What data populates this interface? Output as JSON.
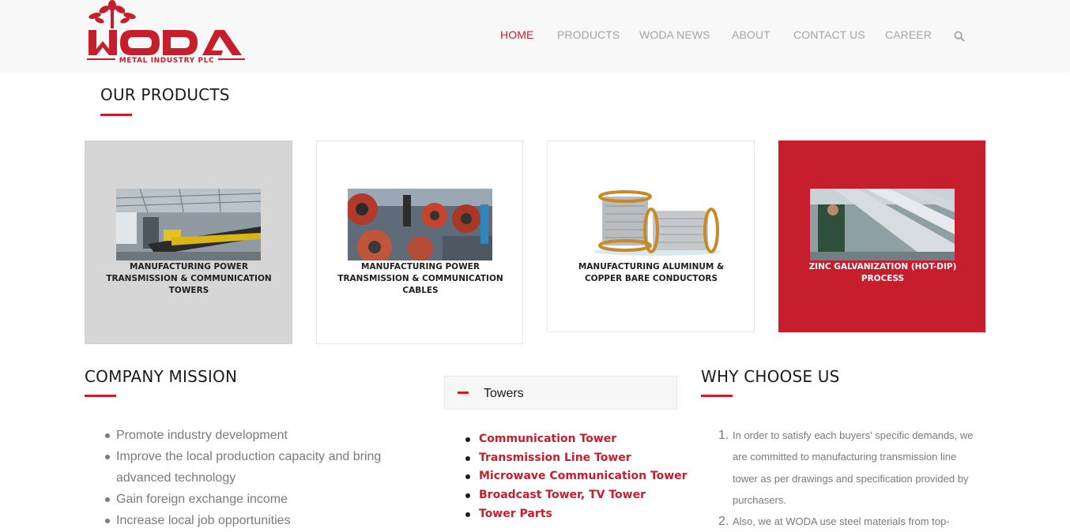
{
  "header": {
    "logo_wordmark": "WODA",
    "logo_tagline": "METAL INDUSTRY PLC",
    "nav": [
      {
        "label": "HOME",
        "active": true
      },
      {
        "label": "PRODUCTS",
        "active": false
      },
      {
        "label": "WODA NEWS",
        "active": false
      },
      {
        "label": "ABOUT",
        "active": false
      },
      {
        "label": "CONTACT US",
        "active": false
      },
      {
        "label": "CAREER",
        "active": false
      }
    ],
    "search_icon": "search-icon"
  },
  "products": {
    "title": "OUR PRODUCTS",
    "items": [
      {
        "caption": "MANUFACTURING POWER TRANSMISSION & COMMUNICATION TOWERS",
        "image": "factory-tower-photo"
      },
      {
        "caption": "MANUFACTURING POWER TRANSMISSION & COMMUNICATION CABLES",
        "image": "cable-factory-photo"
      },
      {
        "caption": "MANUFACTURING ALUMINUM & COPPER BARE CONDUCTORS",
        "image": "wire-spools-photo"
      },
      {
        "caption": "ZINC GALVANIZATION (HOT-DIP) PROCESS",
        "image": "galvanization-photo"
      }
    ]
  },
  "mission": {
    "title": "COMPANY MISSION",
    "items": [
      "Promote industry development",
      "Improve the local production capacity and bring advanced technology",
      "Gain foreign exchange income",
      "Increase local job opportunities"
    ]
  },
  "towers": {
    "accordion_label": "Towers",
    "items": [
      "Communication Tower",
      "Transmission Line Tower",
      "Microwave Communication Tower",
      "Broadcast Tower, TV Tower",
      "Tower Parts"
    ]
  },
  "why": {
    "title": "WHY CHOOSE US",
    "items": [
      {
        "num": "1.",
        "text": "In order to satisfy each buyers' specific demands, we are committed to manufacturing transmission line tower as per drawings and specification provided by purchasers."
      },
      {
        "num": "2.",
        "text": "Also, we at WODA use steel materials from top-"
      }
    ]
  },
  "colors": {
    "brand_red": "#c61e2c",
    "nav_gray": "#a4a4a4",
    "text_gray": "#7a7a7a"
  }
}
